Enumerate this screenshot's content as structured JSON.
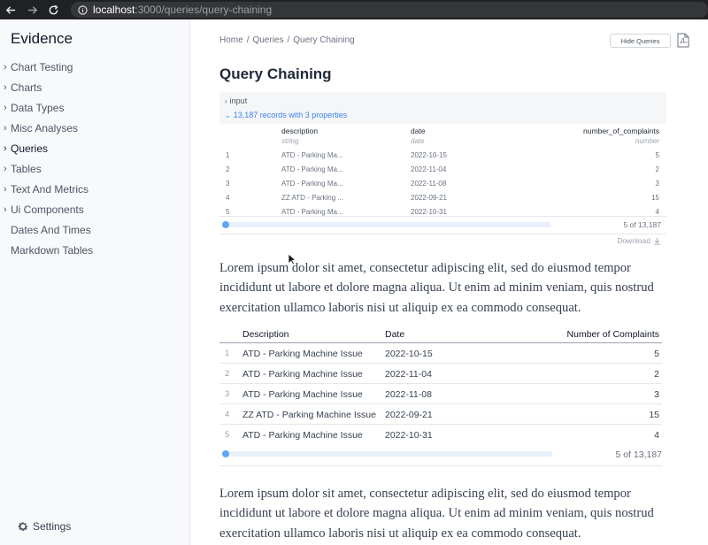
{
  "browser": {
    "url_host": "localhost",
    "url_path": ":3000/queries/query-chaining"
  },
  "sidebar": {
    "brand": "Evidence",
    "items": [
      {
        "label": "Chart Testing",
        "has_children": true
      },
      {
        "label": "Charts",
        "has_children": true
      },
      {
        "label": "Data Types",
        "has_children": true
      },
      {
        "label": "Misc Analyses",
        "has_children": true
      },
      {
        "label": "Queries",
        "has_children": true,
        "active": true
      },
      {
        "label": "Tables",
        "has_children": true
      },
      {
        "label": "Text And Metrics",
        "has_children": true
      },
      {
        "label": "Ui Components",
        "has_children": true
      },
      {
        "label": "Dates And Times",
        "has_children": false
      },
      {
        "label": "Markdown Tables",
        "has_children": false
      }
    ],
    "settings_label": "Settings"
  },
  "header": {
    "breadcrumb": [
      "Home",
      "Queries",
      "Query Chaining"
    ],
    "breadcrumb_sep": "/",
    "hide_queries_label": "Hide Queries"
  },
  "page": {
    "title": "Query Chaining"
  },
  "query_viewer": {
    "input_label": "input",
    "records_label": "13,187 records with 3 properties",
    "columns": [
      "description",
      "date",
      "number_of_complaints"
    ],
    "types": [
      "string",
      "date",
      "number"
    ],
    "rows": [
      {
        "idx": "1",
        "description": "ATD - Parking Ma...",
        "date": "2022-10-15",
        "count": "5"
      },
      {
        "idx": "2",
        "description": "ATD - Parking Ma...",
        "date": "2022-11-04",
        "count": "2"
      },
      {
        "idx": "3",
        "description": "ATD - Parking Ma...",
        "date": "2022-11-08",
        "count": "3"
      },
      {
        "idx": "4",
        "description": "ZZ ATD - Parking ...",
        "date": "2022-09-21",
        "count": "15"
      },
      {
        "idx": "5",
        "description": "ATD - Parking Ma...",
        "date": "2022-10-31",
        "count": "4"
      }
    ],
    "count_label": "5 of 13,187",
    "download_label": "Download"
  },
  "paragraph_1": "Lorem ipsum dolor sit amet, consectetur adipiscing elit, sed do eiusmod tempor incididunt ut labore et dolore magna aliqua. Ut enim ad minim veniam, quis nostrud exercitation ullamco laboris nisi ut aliquip ex ea commodo consequat.",
  "data_table": {
    "columns": [
      "Description",
      "Date",
      "Number of Complaints"
    ],
    "rows": [
      {
        "idx": "1",
        "description": "ATD - Parking Machine Issue",
        "date": "2022-10-15",
        "count": "5"
      },
      {
        "idx": "2",
        "description": "ATD - Parking Machine Issue",
        "date": "2022-11-04",
        "count": "2"
      },
      {
        "idx": "3",
        "description": "ATD - Parking Machine Issue",
        "date": "2022-11-08",
        "count": "3"
      },
      {
        "idx": "4",
        "description": "ZZ ATD - Parking Machine Issue",
        "date": "2022-09-21",
        "count": "15"
      },
      {
        "idx": "5",
        "description": "ATD - Parking Machine Issue",
        "date": "2022-10-31",
        "count": "4"
      }
    ],
    "count_label": "5 of 13,187"
  },
  "paragraph_2": "Lorem ipsum dolor sit amet, consectetur adipiscing elit, sed do eiusmod tempor incididunt ut labore et dolore magna aliqua. Ut enim ad minim veniam, quis nostrud exercitation ullamco laboris nisi ut aliquip ex ea commodo consequat.",
  "colors": {
    "accent": "#3b82f6",
    "sidebar_bg": "#f8f9fb",
    "chrome_bg": "#202124"
  }
}
